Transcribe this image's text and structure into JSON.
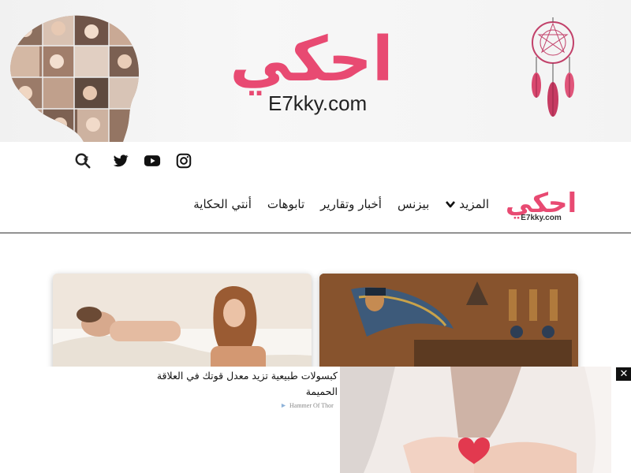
{
  "banner": {
    "logo_arabic": "احكي",
    "logo_domain": "E7kky.com"
  },
  "social": {
    "icons": [
      "search-icon",
      "twitter-icon",
      "youtube-icon",
      "instagram-icon"
    ]
  },
  "nav": {
    "logo_arabic": "احكي",
    "logo_domain": "E7kky.com",
    "items": [
      {
        "label": "أنتي الحكاية"
      },
      {
        "label": "تابوهات"
      },
      {
        "label": "أخبار وتقارير"
      },
      {
        "label": "بيزنس"
      },
      {
        "label": "المزيد"
      }
    ]
  },
  "ad": {
    "headline": "كبسولات طبيعية تزيد معدل قوتك في العلاقة الحميمة",
    "source": "Hammer Of Thor",
    "close_label": "✕"
  },
  "colors": {
    "brand_pink": "#e84a72",
    "text_dark": "#1a1a1a"
  }
}
